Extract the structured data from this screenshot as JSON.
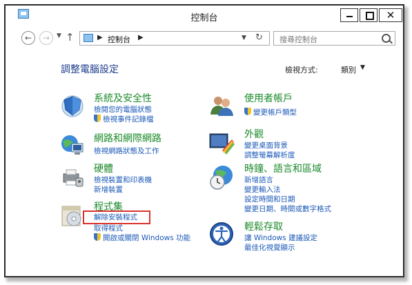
{
  "window": {
    "title": "控制台"
  },
  "nav": {
    "address_crumb": "控制台",
    "search_placeholder": "搜尋控制台"
  },
  "main": {
    "heading": "調整電腦設定",
    "view_by_label": "檢視方式:",
    "view_by_value": "類別"
  },
  "categories": {
    "system": {
      "title": "系統及安全性",
      "links": [
        "檢閱您的電腦狀態",
        "檢視事件記錄檔"
      ]
    },
    "network": {
      "title": "網路和網際網路",
      "links": [
        "檢視網路狀態及工作"
      ]
    },
    "hardware": {
      "title": "硬體",
      "links": [
        "檢視裝置和印表機",
        "新增裝置"
      ]
    },
    "programs": {
      "title": "程式集",
      "links": [
        "解除安裝程式",
        "取得程式",
        "開啟或關閉 Windows 功能"
      ]
    },
    "users": {
      "title": "使用者帳戶",
      "links": [
        "變更帳戶類型"
      ]
    },
    "appearance": {
      "title": "外觀",
      "links": [
        "變更桌面背景",
        "調整螢幕解析度"
      ]
    },
    "clock": {
      "title": "時鐘、語言和區域",
      "links": [
        "新增語言",
        "變更輸入法",
        "設定時間和日期",
        "變更日期、時間或數字格式"
      ]
    },
    "ease": {
      "title": "輕鬆存取",
      "links": [
        "讓 Windows 建議設定",
        "最佳化視覺顯示"
      ]
    }
  },
  "colors": {
    "category_title": "#1b8a2a",
    "link": "#1c5ab8",
    "heading": "#1e3d8c",
    "highlight": "#d9322c"
  },
  "icons": [
    "control-panel-icon",
    "back-arrow-icon",
    "forward-arrow-icon",
    "up-arrow-icon",
    "refresh-icon",
    "search-icon",
    "shield-icon",
    "system-security-icon",
    "network-icon",
    "hardware-icon",
    "programs-icon",
    "users-icon",
    "appearance-icon",
    "clock-globe-icon",
    "ease-of-access-icon"
  ]
}
